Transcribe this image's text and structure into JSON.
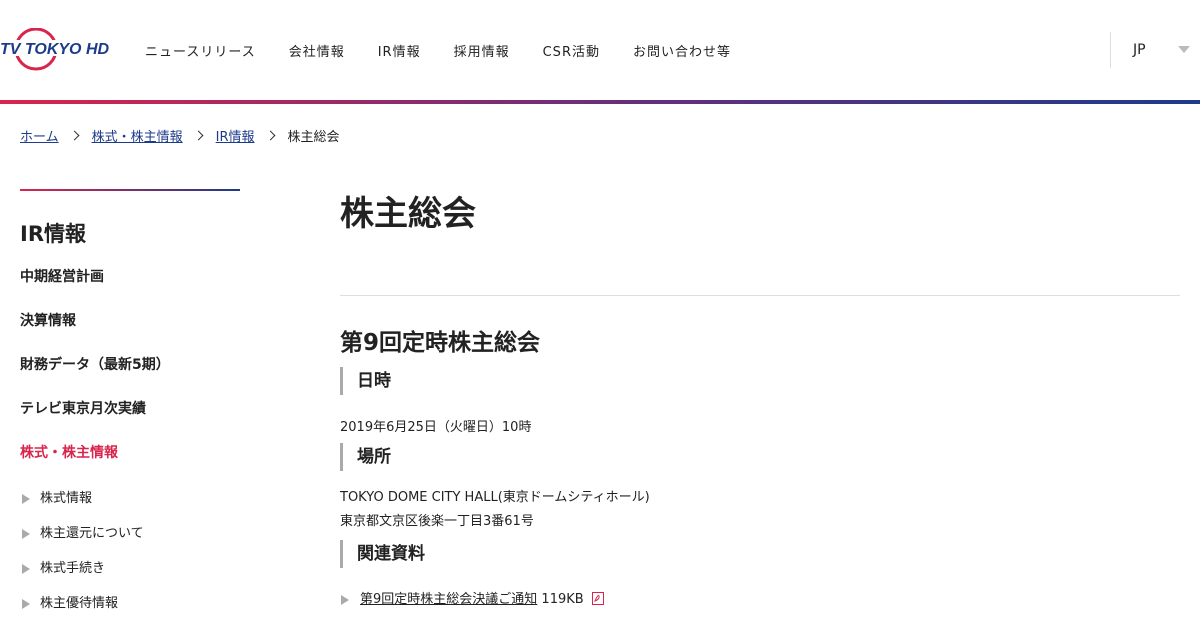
{
  "header": {
    "logo_text": "TV TOKYO HD",
    "nav": [
      "ニュースリリース",
      "会社情報",
      "IR情報",
      "採用情報",
      "CSR活動",
      "お問い合わせ等"
    ],
    "language": "JP"
  },
  "breadcrumb": {
    "items": [
      "ホーム",
      "株式・株主情報",
      "IR情報"
    ],
    "current": "株主総会"
  },
  "sidebar": {
    "title": "IR情報",
    "items": [
      "中期経営計画",
      "決算情報",
      "財務データ（最新5期）",
      "テレビ東京月次実績",
      "株式・株主情報"
    ],
    "active_index": 4,
    "sub_items": [
      "株式情報",
      "株主還元について",
      "株式手続き",
      "株主優待情報"
    ]
  },
  "main": {
    "page_title": "株主総会",
    "section_title": "第9回定時株主総会",
    "datetime_heading": "日時",
    "datetime_value": "2019年6月25日（火曜日）10時",
    "venue_heading": "場所",
    "venue_line1": "TOKYO DOME CITY HALL(東京ドームシティホール)",
    "venue_line2": "東京都文京区後楽一丁目3番61号",
    "materials_heading": "関連資料",
    "materials": [
      {
        "label": "第9回定時株主総会決議ご通知",
        "size": "119KB",
        "icon": "pdf-icon"
      }
    ]
  },
  "colors": {
    "accent_red": "#d8254d",
    "accent_blue": "#1d3b8a"
  }
}
